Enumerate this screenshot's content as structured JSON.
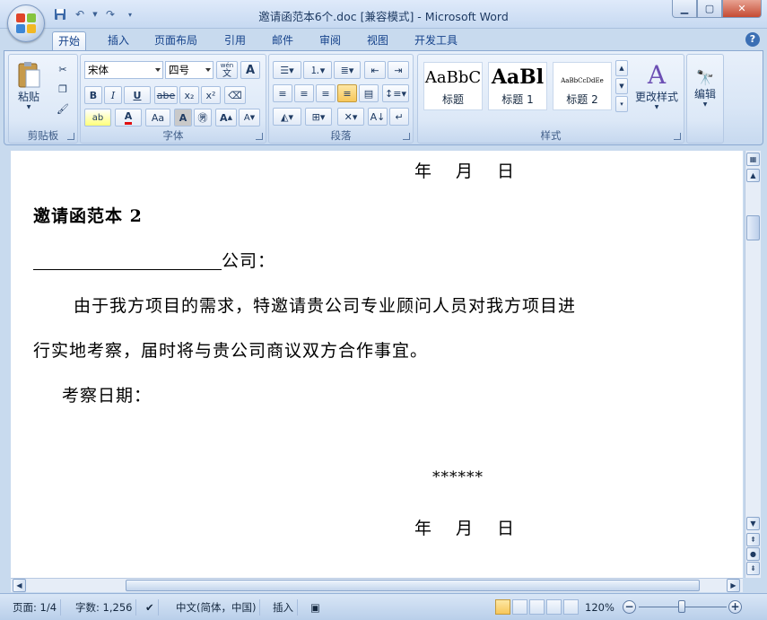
{
  "window": {
    "title": "邀请函范本6个.doc [兼容模式] - Microsoft Word"
  },
  "qat": {
    "save_icon": "save-icon",
    "undo": "↶",
    "redo": "↷"
  },
  "tabs": [
    {
      "label": "开始",
      "active": true
    },
    {
      "label": "插入"
    },
    {
      "label": "页面布局"
    },
    {
      "label": "引用"
    },
    {
      "label": "邮件"
    },
    {
      "label": "审阅"
    },
    {
      "label": "视图"
    },
    {
      "label": "开发工具"
    }
  ],
  "ribbon": {
    "clipboard": {
      "label": "剪贴板",
      "paste": "粘贴"
    },
    "font": {
      "label": "字体",
      "font_name": "宋体",
      "font_size": "四号",
      "bold": "B",
      "italic": "I",
      "underline": "U",
      "strike": "abe",
      "sub": "x₂",
      "sup": "x²",
      "grow": "A",
      "shrink": "A",
      "case": "Aa",
      "phonetic": "wén",
      "phonetic_char": "文"
    },
    "paragraph": {
      "label": "段落"
    },
    "styles": {
      "label": "样式",
      "items": [
        {
          "sample": "AaBbC",
          "name": "标题"
        },
        {
          "sample": "AaBl",
          "name": "标题 1"
        },
        {
          "sample": "AaBbCcDdEe",
          "name": "标题 2"
        }
      ],
      "change": "更改样式"
    },
    "editing": {
      "label": "编辑"
    }
  },
  "document": {
    "line_date_top": "年　月　日",
    "heading": "邀请函范本 2",
    "company_suffix": "公司：",
    "para1": "由于我方项目的需求，特邀请贵公司专业顾问人员对我方项目进",
    "para2": "行实地考察，届时将与贵公司商议双方合作事宜。",
    "inspect_date": "考察日期：",
    "stars": "******",
    "line_date_bottom": "年　月　日"
  },
  "status": {
    "page": "页面: 1/4",
    "words": "字数: 1,256",
    "language": "中文(简体，中国)",
    "mode": "插入",
    "zoom": "120%"
  },
  "colors": {
    "accent": "#15428b",
    "highlight": "#ffff00",
    "font_red": "#e01010"
  }
}
